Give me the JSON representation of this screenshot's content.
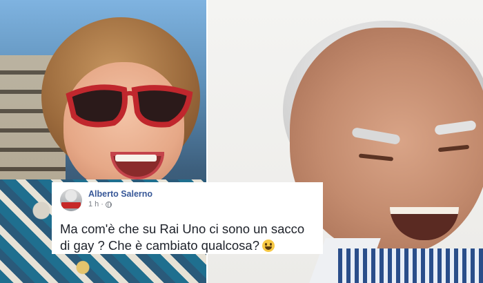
{
  "post": {
    "author": "Alberto Salerno",
    "time": "1 h",
    "separator": "·",
    "text": "Ma com'è che su Rai Uno ci sono un sacco di gay ? Che è cambiato qualcosa?",
    "emoji": "grinning-face-emoji",
    "privacy_icon": "globe-icon"
  },
  "colors": {
    "author_link": "#385898",
    "meta_gray": "#7a7f87",
    "text": "#1d2129"
  }
}
